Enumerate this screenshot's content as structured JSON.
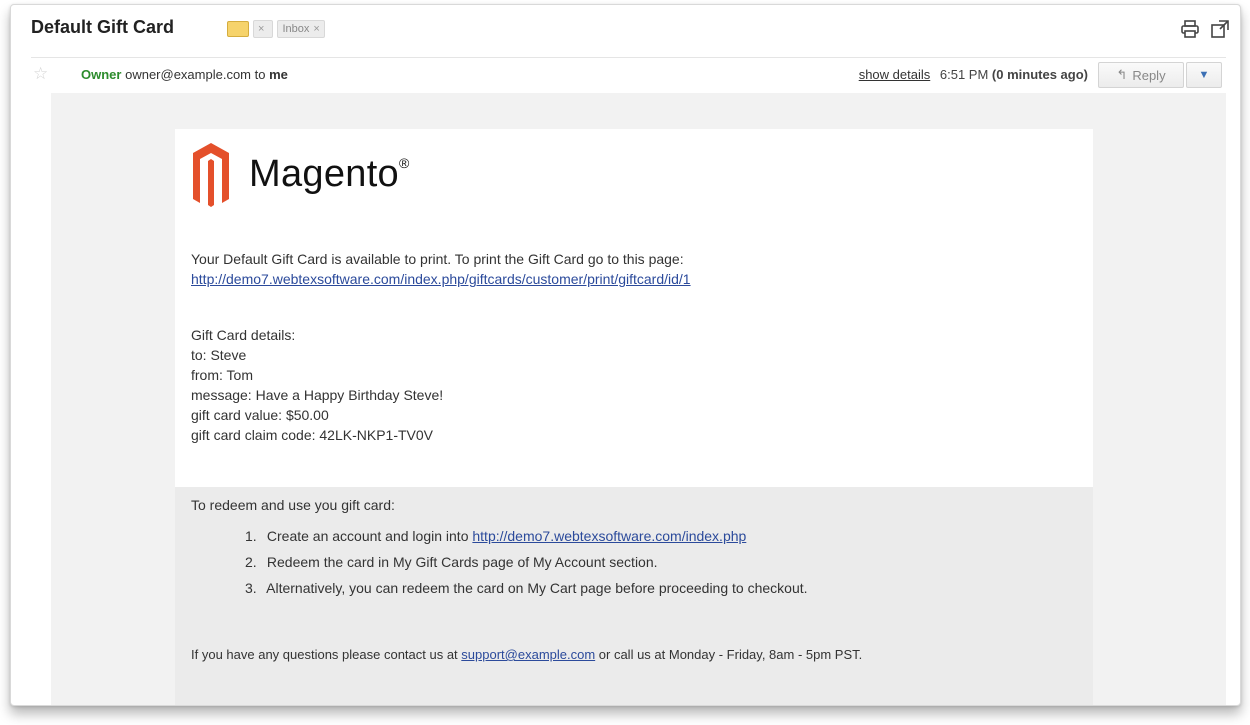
{
  "subject": "Default Gift Card",
  "label_inbox": "Inbox",
  "sender": {
    "name": "Owner",
    "email": "owner@example.com",
    "to_prefix": "to",
    "to": "me",
    "show_details": "show details",
    "time": "6:51 PM",
    "ago": "(0 minutes ago)",
    "reply": "Reply"
  },
  "logo": {
    "brand": "Magento",
    "brand_color": "#e4502b"
  },
  "intro": {
    "text": "Your Default Gift Card is available to print. To print the Gift Card go to this page:",
    "link": "http://demo7.webtexsoftware.com/index.php/giftcards/customer/print/giftcard/id/1"
  },
  "details": {
    "heading": "Gift Card details:",
    "to": "to: Steve",
    "from": "from: Tom",
    "message": "message: Have a Happy Birthday Steve!",
    "value": "gift card value: $50.00",
    "code": "gift card claim code: 42LK-NKP1-TV0V"
  },
  "redeem": {
    "heading": "To redeem and use you gift card:",
    "steps": [
      {
        "num": "1.",
        "text": "Create an account and login into ",
        "link": "http://demo7.webtexsoftware.com/index.php"
      },
      {
        "num": "2.",
        "text": "Redeem the card in My Gift Cards page of My Account section.",
        "link": ""
      },
      {
        "num": "3.",
        "text": "Alternatively, you can redeem the card on My Cart page before proceeding to checkout.",
        "link": ""
      }
    ],
    "contact_before": "If you have any questions please contact us at ",
    "contact_email": "support@example.com",
    "contact_after": " or call us at Monday - Friday, 8am - 5pm PST."
  }
}
